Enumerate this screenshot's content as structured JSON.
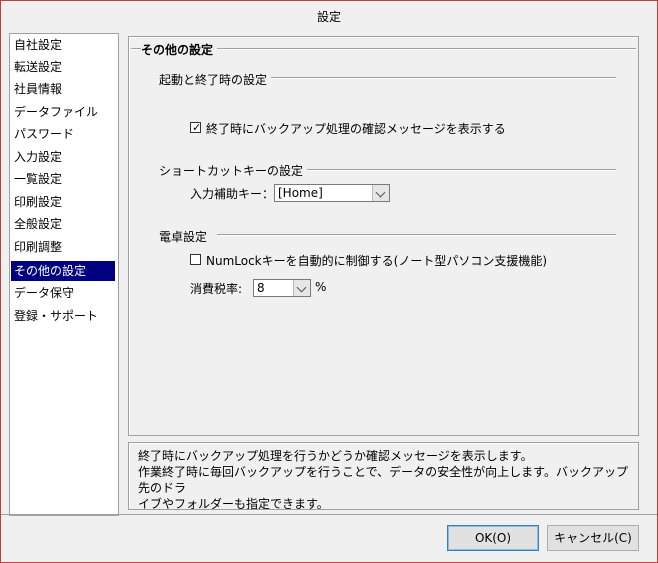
{
  "window": {
    "title": "設定"
  },
  "sidebar": {
    "items": [
      {
        "label": "自社設定"
      },
      {
        "label": "転送設定"
      },
      {
        "label": "社員情報"
      },
      {
        "label": "データファイル"
      },
      {
        "label": "パスワード"
      },
      {
        "label": "入力設定"
      },
      {
        "label": "一覧設定"
      },
      {
        "label": "印刷設定"
      },
      {
        "label": "全般設定"
      },
      {
        "label": "印刷調整"
      },
      {
        "label": "その他の設定",
        "selected": true
      },
      {
        "label": "データ保守"
      },
      {
        "label": "登録・サポート"
      }
    ]
  },
  "panel": {
    "title": "その他の設定",
    "startup": {
      "title": "起動と終了時の設定",
      "backup_confirm": {
        "label": "終了時にバックアップ処理の確認メッセージを表示する",
        "checked": true
      }
    },
    "shortcut": {
      "title": "ショートカットキーの設定",
      "input_assist_label": "入力補助キー：",
      "input_assist_value": "[Home]"
    },
    "calculator": {
      "title": "電卓設定",
      "numlock": {
        "label": "NumLockキーを自動的に制御する(ノート型パソコン支援機能)",
        "checked": false
      },
      "tax_label": "消費税率:",
      "tax_value": "8",
      "tax_unit": "%"
    }
  },
  "description": {
    "lines": [
      "終了時にバックアップ処理を行うかどうか確認メッセージを表示します。",
      "作業終了時に毎回バックアップを行うことで、データの安全性が向上します。バックアップ先のドラ",
      "イブやフォルダーも指定できます。"
    ]
  },
  "buttons": {
    "ok": "OK(O)",
    "cancel": "キャンセル(C)"
  }
}
